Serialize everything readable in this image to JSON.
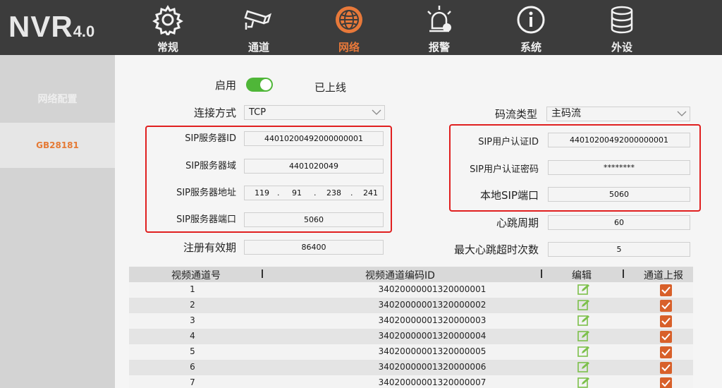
{
  "logo": {
    "main": "NVR",
    "version": "4.0"
  },
  "nav": [
    {
      "label": "常规",
      "icon": "gear-icon"
    },
    {
      "label": "通道",
      "icon": "camera-icon"
    },
    {
      "label": "网络",
      "icon": "globe-icon",
      "active": true
    },
    {
      "label": "报警",
      "icon": "alarm-icon"
    },
    {
      "label": "系统",
      "icon": "info-icon"
    },
    {
      "label": "外设",
      "icon": "database-icon"
    }
  ],
  "sidebar": {
    "items": [
      {
        "label": "网络配置"
      },
      {
        "label": "GB28181"
      }
    ]
  },
  "form": {
    "enable_label": "启用",
    "enabled": true,
    "status": "已上线",
    "conn_label": "连接方式",
    "conn_value": "TCP",
    "sip_server_id_label": "SIP服务器ID",
    "sip_server_id": "44010200492000000001",
    "sip_domain_label": "SIP服务器域",
    "sip_domain": "4401020049",
    "sip_addr_label": "SIP服务器地址",
    "sip_addr": [
      "119",
      "91",
      "238",
      "241"
    ],
    "sip_addr_dot": ".",
    "sip_port_label": "SIP服务器端口",
    "sip_port": "5060",
    "reg_label": "注册有效期",
    "reg_value": "86400",
    "stream_label": "码流类型",
    "stream_value": "主码流",
    "user_id_label": "SIP用户认证ID",
    "user_id": "44010200492000000001",
    "user_pwd_label": "SIP用户认证密码",
    "user_pwd": "********",
    "local_port_label": "本地SIP端口",
    "local_port": "5060",
    "heartbeat_label": "心跳周期",
    "heartbeat": "60",
    "max_hb_label": "最大心跳超时次数",
    "max_hb": "5"
  },
  "table": {
    "headers": [
      "视频通道号",
      "视频通道编码ID",
      "编辑",
      "通道上报"
    ],
    "rows": [
      {
        "no": "1",
        "id": "34020000001320000001"
      },
      {
        "no": "2",
        "id": "34020000001320000002"
      },
      {
        "no": "3",
        "id": "34020000001320000003"
      },
      {
        "no": "4",
        "id": "34020000001320000004"
      },
      {
        "no": "5",
        "id": "34020000001320000005"
      },
      {
        "no": "6",
        "id": "34020000001320000006"
      },
      {
        "no": "7",
        "id": "34020000001320000007"
      }
    ]
  },
  "colors": {
    "accent": "#e8793a",
    "toggle": "#4fb638",
    "highlight": "#e01f1f",
    "check": "#d8602a",
    "edit": "#7cc04a"
  }
}
